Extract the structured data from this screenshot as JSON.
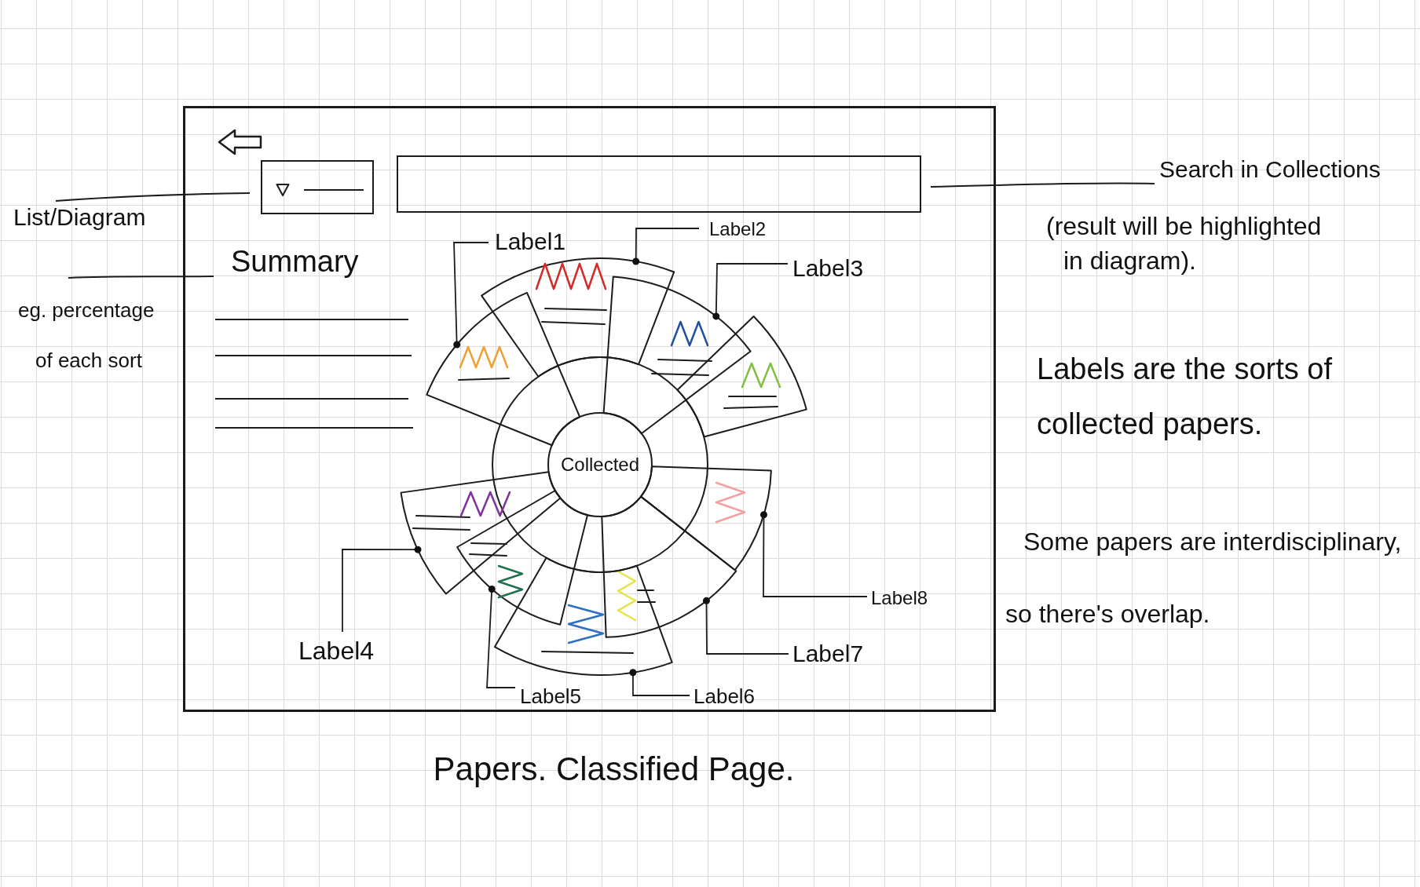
{
  "notes_left": [
    "List/Diagram",
    "eg. percentage of each sort"
  ],
  "screen": {
    "summary": {
      "title": "Summary"
    },
    "diagram": {
      "center_label": "Collected",
      "segments": [
        {
          "label": "Label1",
          "color": "#f0a030"
        },
        {
          "label": "Label2",
          "color": "#d42a2a"
        },
        {
          "label": "Label3",
          "color": "#2050a0"
        },
        {
          "color": "#80c040"
        },
        {
          "label": "Label8",
          "color": "#f4a0a0"
        },
        {
          "label": "Label7",
          "color": "#e8e450"
        },
        {
          "label": "Label6",
          "color": "#3070c0"
        },
        {
          "label": "Label5",
          "color": "#207050"
        },
        {
          "label": "Label4",
          "color": "#8030a0"
        }
      ]
    }
  },
  "notes_right": [
    "Search in Collections",
    "(result will be highlighted in diagram).",
    "Labels are the sorts of collected papers.",
    "Some papers are interdisciplinary, so there's overlap."
  ],
  "caption": "Papers. Classified Page."
}
